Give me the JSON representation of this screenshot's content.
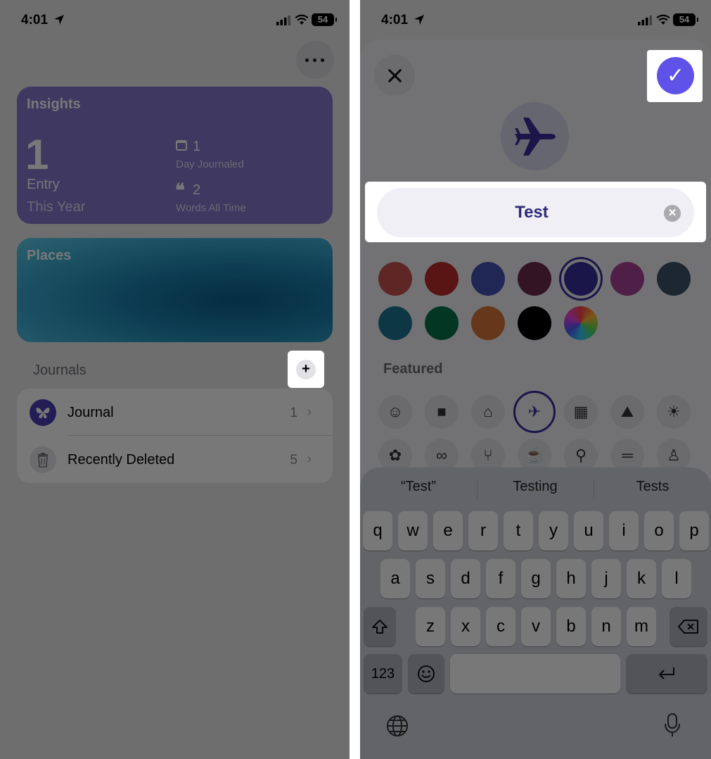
{
  "left": {
    "status": {
      "time": "4:01",
      "battery": "54"
    },
    "insights": {
      "title": "Insights",
      "entries_value": "1",
      "entries_label": "Entry",
      "entries_period": "This Year",
      "days_value": "1",
      "days_label": "Day Journaled",
      "words_value": "2",
      "words_label": "Words All Time"
    },
    "places": {
      "title": "Places"
    },
    "journals": {
      "header": "Journals",
      "add_label": "+",
      "items": [
        {
          "name": "Journal",
          "count": "1",
          "icon": "butterfly-icon"
        },
        {
          "name": "Recently Deleted",
          "count": "5",
          "icon": "trash-icon"
        }
      ]
    }
  },
  "right": {
    "status": {
      "time": "4:01",
      "battery": "54"
    },
    "check_label": "✓",
    "name_input": {
      "value": "Test",
      "clear_label": "✕"
    },
    "selected_icon": "airplane-icon",
    "colors": [
      "#c8524f",
      "#bb2d2a",
      "#4553b5",
      "#6b2b4b",
      "#3a2f9e",
      "#a94397",
      "#3c5468",
      "#1e7592",
      "#08744b",
      "#d87638",
      "#000000",
      "multicolor"
    ],
    "selected_color": "#3a2f9e",
    "featured": {
      "header": "Featured",
      "icons": [
        "smiley-icon",
        "bag-icon",
        "house-icon",
        "airplane-icon",
        "map-icon",
        "mountains-icon",
        "sun-icon",
        "tulip-icon",
        "binoculars-icon",
        "fork-knife-icon",
        "cup-icon",
        "runner-icon",
        "dumbbell-icon",
        "family-icon"
      ],
      "selected": "airplane-icon"
    },
    "keyboard": {
      "suggestions": [
        "“Test”",
        "Testing",
        "Tests"
      ],
      "row1": [
        "q",
        "w",
        "e",
        "r",
        "t",
        "y",
        "u",
        "i",
        "o",
        "p"
      ],
      "row2": [
        "a",
        "s",
        "d",
        "f",
        "g",
        "h",
        "j",
        "k",
        "l"
      ],
      "row3": [
        "z",
        "x",
        "c",
        "v",
        "b",
        "n",
        "m"
      ],
      "numbers_label": "123"
    }
  }
}
